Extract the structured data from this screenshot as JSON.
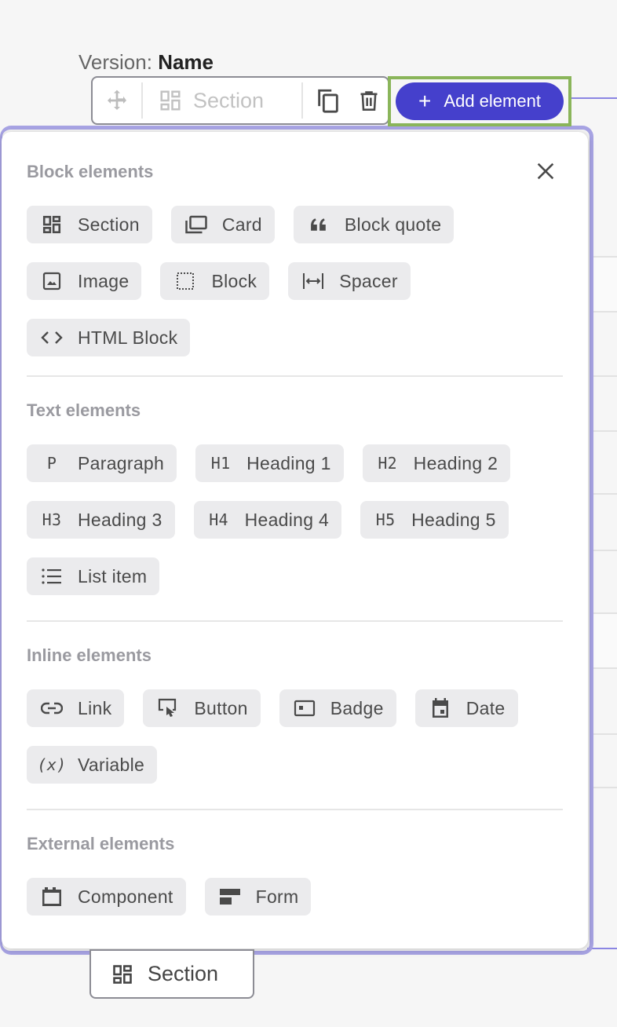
{
  "header": {
    "version_prefix": "Version:",
    "version_name": "Name"
  },
  "toolbar": {
    "move_icon": "move-arrows-icon",
    "element_type_label": "Section",
    "element_type_icon": "section-grid-icon",
    "duplicate_icon": "copy-icon",
    "delete_icon": "trash-icon",
    "add_element_label": "Add element",
    "add_element_icon": "plus-icon"
  },
  "panel": {
    "close_icon": "close-icon",
    "groups": [
      {
        "title": "Block elements",
        "items": [
          {
            "label": "Section",
            "icon": "section-grid-icon"
          },
          {
            "label": "Card",
            "icon": "card-stack-icon"
          },
          {
            "label": "Block quote",
            "icon": "quote-icon"
          },
          {
            "label": "Image",
            "icon": "image-icon"
          },
          {
            "label": "Block",
            "icon": "dashed-square-icon"
          },
          {
            "label": "Spacer",
            "icon": "spacer-icon"
          },
          {
            "label": "HTML Block",
            "icon": "code-brackets-icon"
          }
        ]
      },
      {
        "title": "Text elements",
        "items": [
          {
            "label": "Paragraph",
            "icon": "paragraph-icon",
            "tag": "P"
          },
          {
            "label": "Heading 1",
            "icon": "h1-icon",
            "tag": "H1"
          },
          {
            "label": "Heading 2",
            "icon": "h2-icon",
            "tag": "H2"
          },
          {
            "label": "Heading 3",
            "icon": "h3-icon",
            "tag": "H3"
          },
          {
            "label": "Heading 4",
            "icon": "h4-icon",
            "tag": "H4"
          },
          {
            "label": "Heading 5",
            "icon": "h5-icon",
            "tag": "H5"
          },
          {
            "label": "List item",
            "icon": "list-icon"
          }
        ]
      },
      {
        "title": "Inline elements",
        "items": [
          {
            "label": "Link",
            "icon": "link-icon"
          },
          {
            "label": "Button",
            "icon": "button-click-icon"
          },
          {
            "label": "Badge",
            "icon": "badge-icon"
          },
          {
            "label": "Date",
            "icon": "calendar-icon"
          },
          {
            "label": "Variable",
            "icon": "variable-icon",
            "tag": "(x)"
          }
        ]
      },
      {
        "title": "External elements",
        "items": [
          {
            "label": "Component",
            "icon": "component-icon"
          },
          {
            "label": "Form",
            "icon": "form-icon"
          }
        ]
      }
    ]
  },
  "bottom_tag": {
    "label": "Section",
    "icon": "section-grid-icon"
  },
  "colors": {
    "accent": "#4540cc",
    "selection": "#a7a3e3",
    "highlight": "#8ab55a",
    "chip_bg": "#ebebed",
    "group_title": "#9a9aa0"
  }
}
